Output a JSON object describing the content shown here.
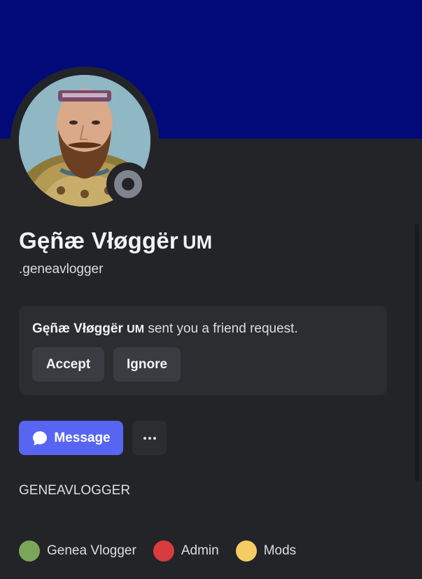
{
  "profile": {
    "display_name": "Gęñæ Vłøggër",
    "name_tag": "UM",
    "username": ".geneavlogger",
    "status": "offline",
    "bio": "GENEAVLOGGER"
  },
  "friend_request": {
    "name": "Gęñæ Vłøggër",
    "tag": "UM",
    "text": "sent you a friend request.",
    "accept_label": "Accept",
    "ignore_label": "Ignore"
  },
  "actions": {
    "message_label": "Message",
    "more_icon": "more-horizontal-icon"
  },
  "roles": [
    {
      "name": "Genea Vlogger",
      "color": "#7ba65a"
    },
    {
      "name": "Admin",
      "color": "#d83c3e"
    },
    {
      "name": "Mods",
      "color": "#f5cb64"
    }
  ],
  "colors": {
    "banner": "#020a7a",
    "accent": "#5865f2",
    "background": "#232428"
  }
}
